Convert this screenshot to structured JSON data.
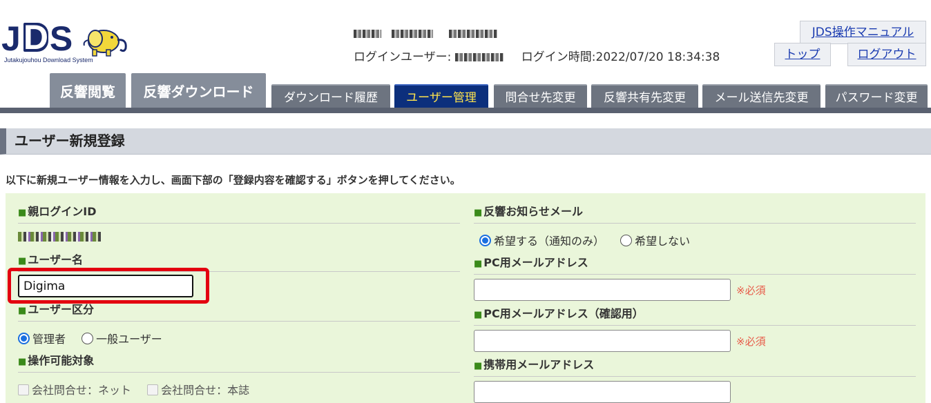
{
  "header": {
    "logo_text_1": "J",
    "logo_text_2": "D",
    "logo_text_3": "S",
    "logo_subtitle": "Jutakujouhou Download System",
    "login_user_label": "ログインユーザー:",
    "login_time_label": "ログイン時間:",
    "login_time": "2022/07/20 18:34:38",
    "manual_link": "JDS操作マニュアル",
    "top_link": "トップ",
    "logout_link": "ログアウト"
  },
  "tabs": [
    {
      "label": "反響閲覧"
    },
    {
      "label": "反響ダウンロード"
    },
    {
      "label": "ダウンロード履歴"
    },
    {
      "label": "ユーザー管理"
    },
    {
      "label": "問合せ先変更"
    },
    {
      "label": "反響共有先変更"
    },
    {
      "label": "メール送信先変更"
    },
    {
      "label": "パスワード変更"
    }
  ],
  "page": {
    "title": "ユーザー新規登録",
    "instruction": "以下に新規ユーザー情報を入力し、画面下部の「登録内容を確認する」ボタンを押してください。"
  },
  "form": {
    "left": {
      "parent_id_label": "親ログインID",
      "username_label": "ユーザー名",
      "username_value": "Digima",
      "usertype_label": "ユーザー区分",
      "usertype_options": [
        "管理者",
        "一般ユーザー"
      ],
      "scope_label": "操作可能対象",
      "scope_options": [
        "会社問合せ：ネット",
        "会社問合せ：本誌"
      ]
    },
    "right": {
      "notify_label": "反響お知らせメール",
      "notify_options": [
        "希望する（通知のみ）",
        "希望しない"
      ],
      "pc_mail_label": "PC用メールアドレス",
      "pc_mail_confirm_label": "PC用メールアドレス（確認用）",
      "mobile_mail_label": "携帯用メールアドレス",
      "required": "※必須"
    },
    "square": "■"
  },
  "colors": {
    "accent_red": "#e3000f",
    "tab_active": "#0c2f7c",
    "panel_bg": "#eaf6da"
  }
}
